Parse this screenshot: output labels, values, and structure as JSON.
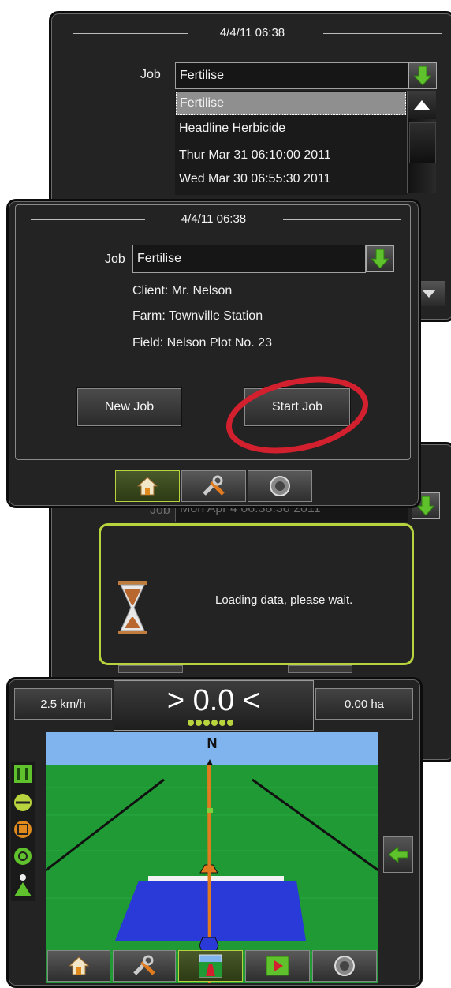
{
  "panel1": {
    "datetime": "4/4/11 06:38",
    "job_label": "Job",
    "job_value": "Fertilise",
    "list": [
      "Fertilise",
      "Headline Herbicide",
      "Thur Mar 31 06:10:00 2011",
      "Wed Mar 30 06:55:30 2011"
    ]
  },
  "panel2": {
    "datetime": "4/4/11 06:38",
    "job_label": "Job",
    "job_value": "Fertilise",
    "client": "Client: Mr. Nelson",
    "farm": "Farm: Townville Station",
    "field": "Field: Nelson Plot No. 23",
    "new_job_label": "New Job",
    "start_job_label": "Start Job"
  },
  "panel3": {
    "job_label": "Job",
    "job_value": "Mon Apr 4 06:38:30 2011",
    "loading_text": "Loading data, please wait."
  },
  "panel4": {
    "speed": "2.5 km/h",
    "guidance": "> 0.0 <",
    "area": "0.00 ha",
    "compass": "N"
  },
  "colors": {
    "accent_green": "#b7d33d",
    "highlight_red": "#d2202f",
    "field_blue": "#2a3ad8",
    "sky_blue": "#7fb4ee",
    "ground_green": "#1f9a34"
  }
}
